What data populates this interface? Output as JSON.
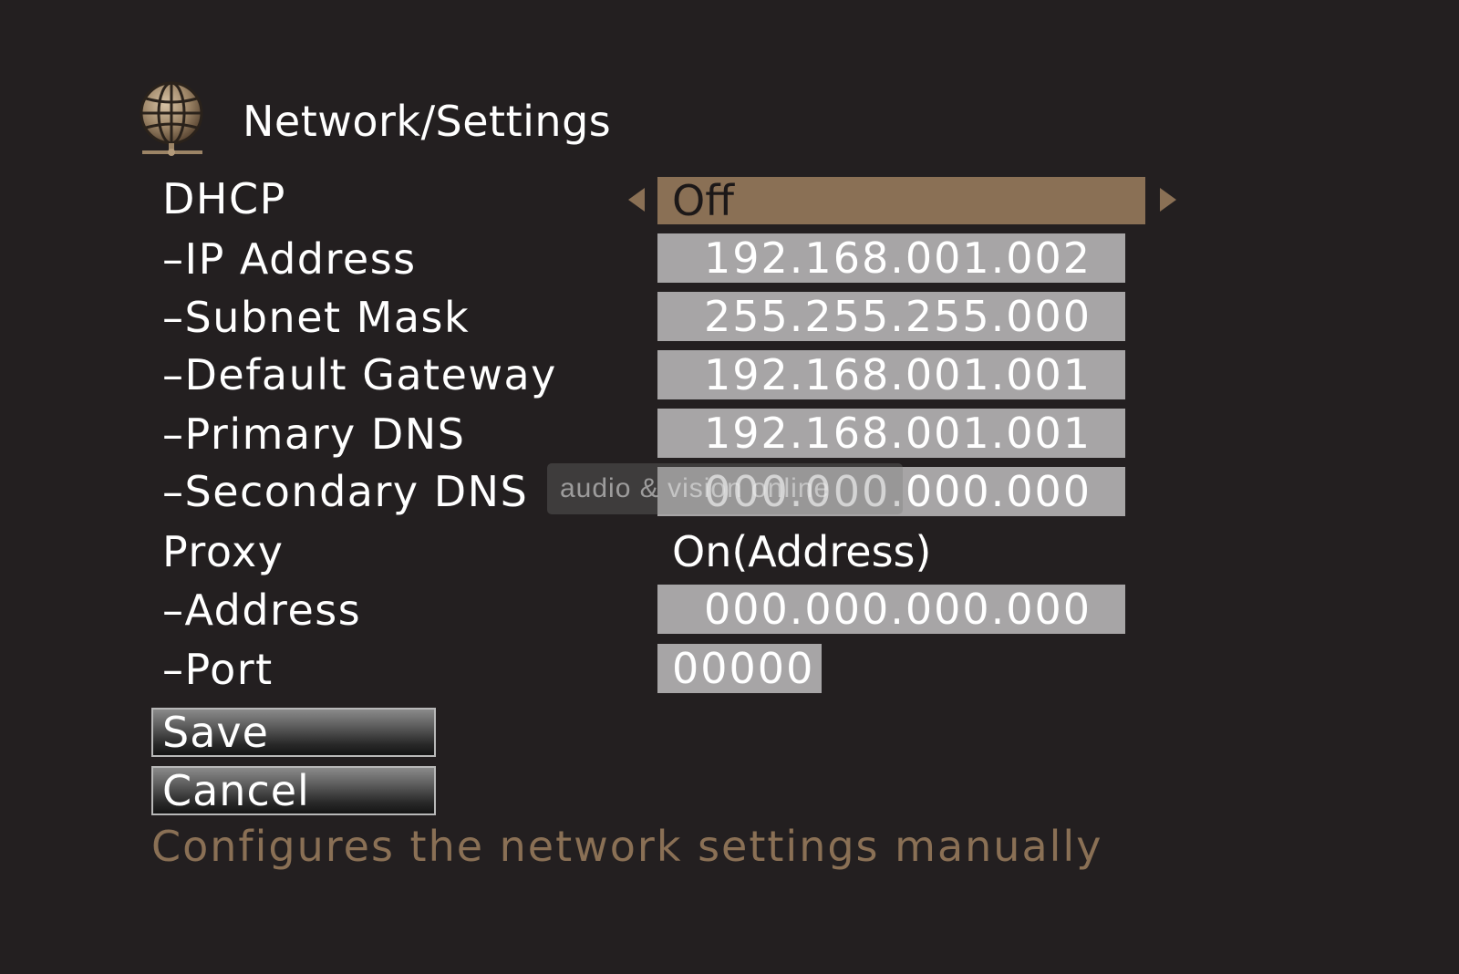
{
  "header": {
    "title": "Network/Settings",
    "icon": "globe-network-icon"
  },
  "dhcp": {
    "label": "DHCP",
    "value": "Off"
  },
  "fields": [
    {
      "label": "–IP Address",
      "value": "192.168.001.002"
    },
    {
      "label": "–Subnet Mask",
      "value": "255.255.255.000"
    },
    {
      "label": "–Default Gateway",
      "value": "192.168.001.001"
    },
    {
      "label": "–Primary DNS",
      "value": "192.168.001.001"
    },
    {
      "label": "–Secondary DNS",
      "value": "000.000.000.000"
    }
  ],
  "proxy": {
    "label": "Proxy",
    "value": "On(Address)",
    "address_label": "–Address",
    "address_value": "000.000.000.000",
    "port_label": "–Port",
    "port_value": "00000"
  },
  "buttons": {
    "save": "Save",
    "cancel": "Cancel"
  },
  "help_text": "Configures the network settings manually",
  "watermark": "audio & vision online",
  "colors": {
    "background": "#231f20",
    "accent": "#8a7055",
    "field": "#a7a5a6",
    "text": "#ffffff"
  }
}
